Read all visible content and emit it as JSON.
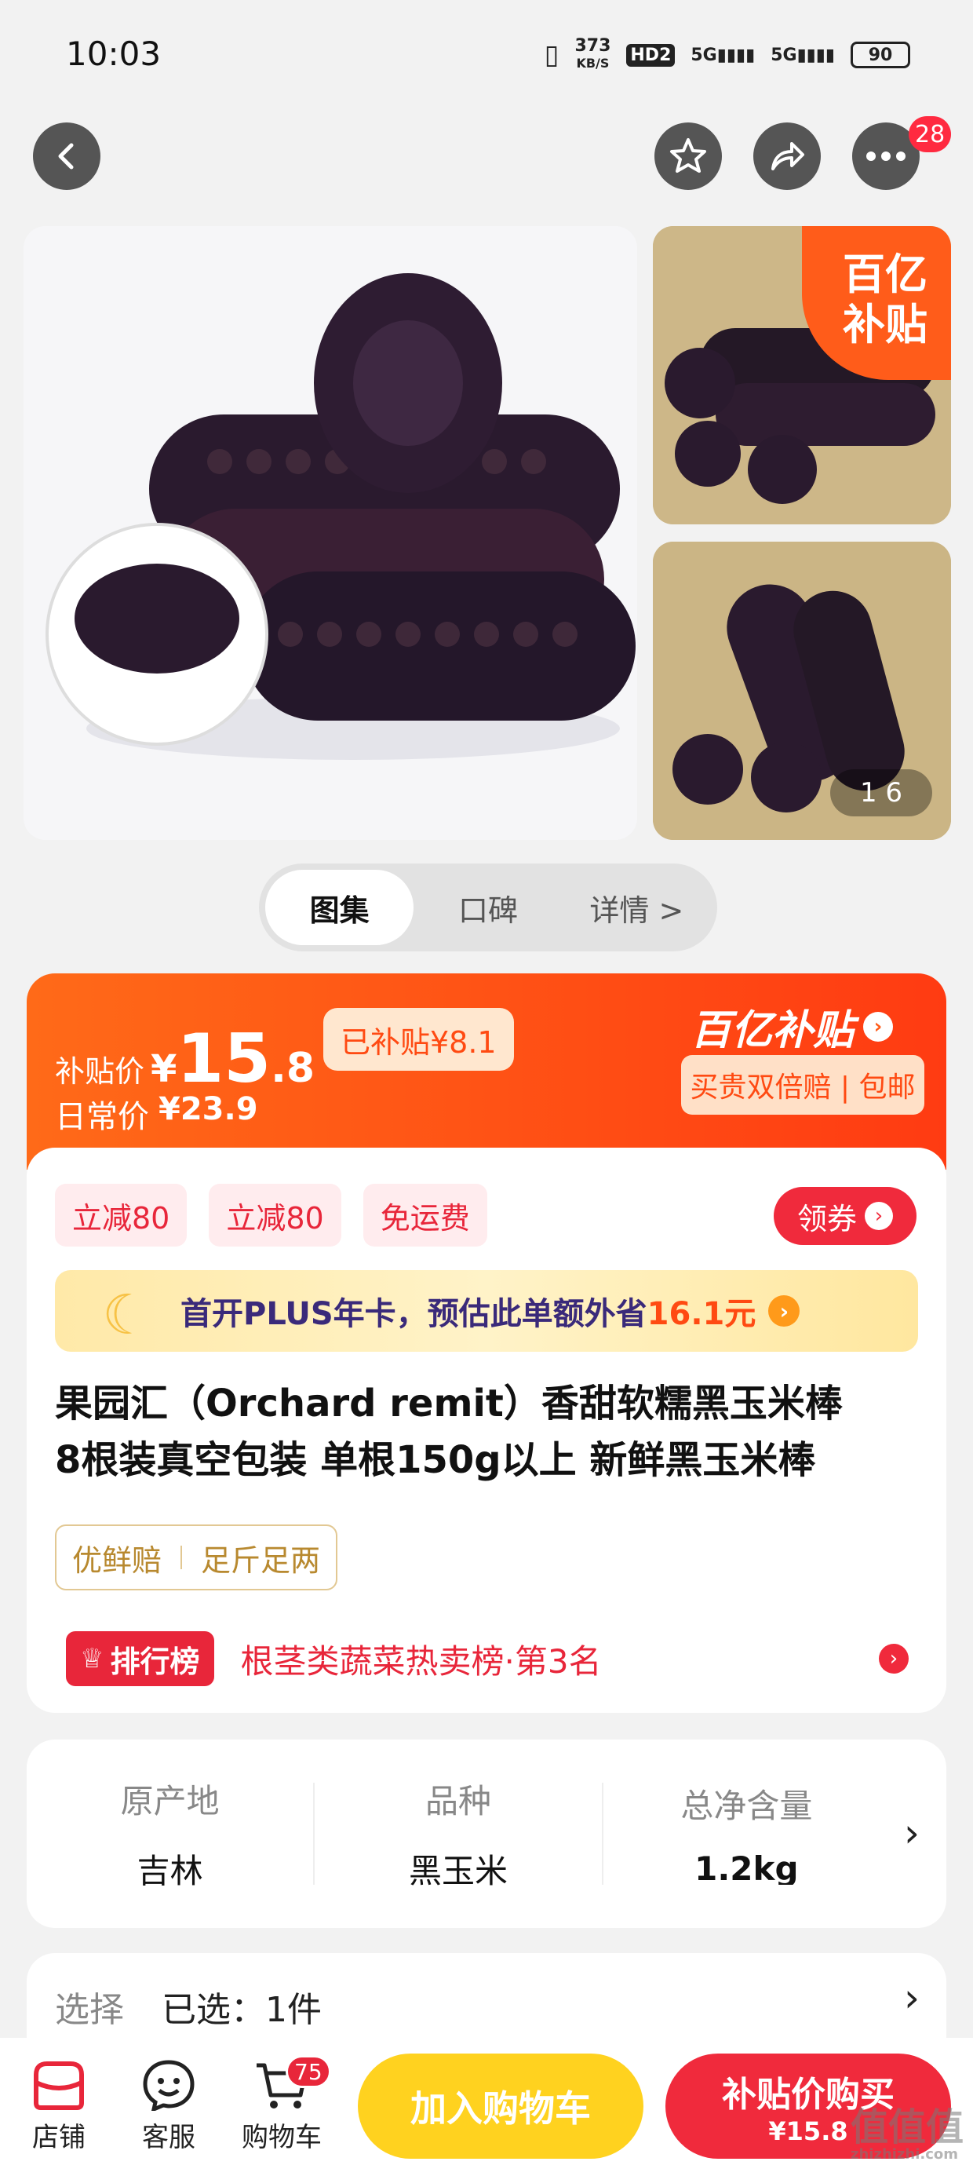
{
  "status_bar": {
    "time": "10:03",
    "speed_top": "373",
    "speed_unit": "KB/S",
    "hd": "HD2",
    "net1": "5G",
    "net2": "5G",
    "battery": "90"
  },
  "header": {
    "cart_badge": "28"
  },
  "gallery": {
    "badge_line1": "百亿",
    "badge_line2": "补贴",
    "counter": "1  6"
  },
  "tabs": [
    {
      "label": "图集"
    },
    {
      "label": "口碑"
    },
    {
      "label": "详情 >"
    }
  ],
  "price": {
    "subsidy_label": "补贴价",
    "currency": "¥",
    "main_int": "15",
    "main_dec": ".8",
    "subsidized_tag": "已补贴¥8.1",
    "daily_label": "日常价",
    "daily_price": "¥23.9",
    "brand": "百亿补贴",
    "guarantee": "买贵双倍赔 | 包邮"
  },
  "coupons": [
    {
      "label": "立减80"
    },
    {
      "label": "立减80"
    },
    {
      "label": "免运费"
    }
  ],
  "coupon_button": "领券",
  "plus_banner": {
    "text_a": "首开PLUS年卡，预估此单额外省",
    "amount": "16.1元"
  },
  "product": {
    "title_line1": "果园汇（Orchard remit）香甜软糯黑玉米棒",
    "title_line2": "8根装真空包装 单根150g以上 新鲜黑玉米棒"
  },
  "tags": [
    {
      "label": "优鲜赔"
    },
    {
      "label": "足斤足两"
    }
  ],
  "ranking": {
    "badge": "排行榜",
    "text": "根茎类蔬菜热卖榜·第3名"
  },
  "specs": [
    {
      "label": "原产地",
      "value": "吉林"
    },
    {
      "label": "品种",
      "value": "黑玉米"
    },
    {
      "label": "总净含量",
      "value": "1.2kg"
    }
  ],
  "selection": {
    "label": "选择",
    "value": "已选：1件"
  },
  "bottom_bar": {
    "shop": "店铺",
    "service": "客服",
    "cart": "购物车",
    "cart_badge": "75",
    "add_cart": "加入购物车",
    "buy_line1": "补贴价购买",
    "buy_line2": "¥15.8"
  },
  "watermark": {
    "main": "值值值",
    "sub": "zhizhizhi.com"
  },
  "colors": {
    "accent": "#ff4a12",
    "red": "#e8263a",
    "yellow": "#ffd21f",
    "buy": "#f02a3c"
  }
}
